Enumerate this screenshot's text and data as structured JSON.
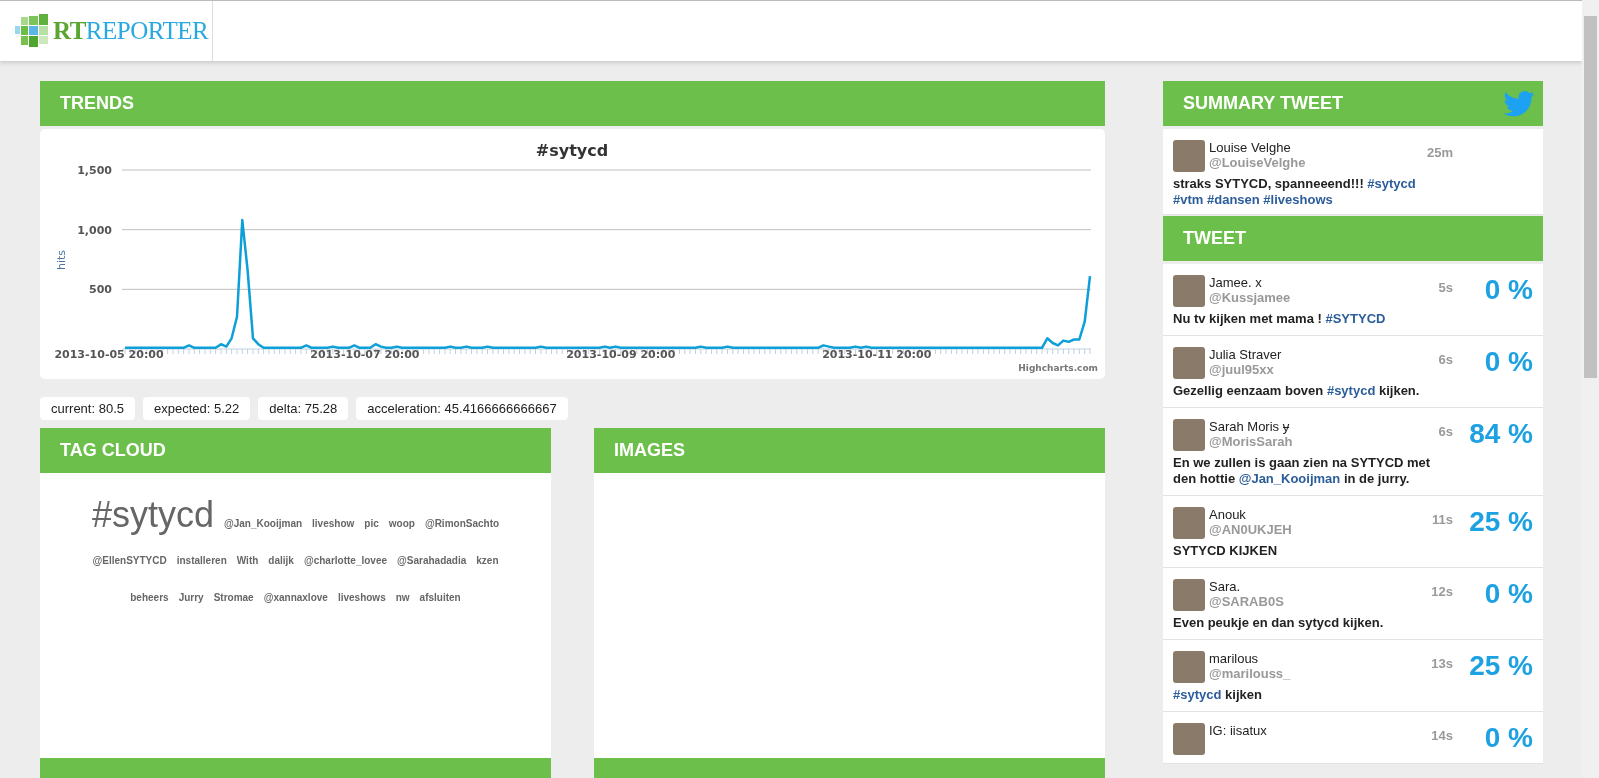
{
  "header": {
    "logo": {
      "prefix": "RT",
      "suffix": "REPORTER"
    }
  },
  "trends": {
    "title": "TRENDS",
    "credit": "Highcharts.com",
    "chart_data": {
      "type": "line",
      "title": "#sytycd",
      "ylabel": "hits",
      "ylim": [
        0,
        1500
      ],
      "yticks": [
        500,
        {
          "value": 1000,
          "label": "1,000"
        },
        {
          "value": 1500,
          "label": "1,500"
        }
      ],
      "categories": [
        "2013-10-05 20:00",
        null,
        null,
        null,
        null,
        null,
        null,
        null,
        null,
        null,
        null,
        null,
        null,
        null,
        null,
        null,
        null,
        null,
        null,
        null,
        null,
        null,
        null,
        null,
        null,
        null,
        null,
        null,
        null,
        null,
        null,
        null,
        null,
        null,
        null,
        null,
        null,
        null,
        null,
        null,
        null,
        null,
        null,
        null,
        null,
        null,
        null,
        null,
        "2013-10-07 20:00",
        null,
        null,
        null,
        null,
        null,
        null,
        null,
        null,
        null,
        null,
        null,
        null,
        null,
        null,
        null,
        null,
        null,
        null,
        null,
        null,
        null,
        null,
        null,
        null,
        null,
        null,
        null,
        null,
        null,
        null,
        null,
        null,
        null,
        null,
        null,
        null,
        null,
        null,
        null,
        null,
        null,
        null,
        null,
        null,
        null,
        null,
        null,
        "2013-10-09 20:00",
        null,
        null,
        null,
        null,
        null,
        null,
        null,
        null,
        null,
        null,
        null,
        null,
        null,
        null,
        null,
        null,
        null,
        null,
        null,
        null,
        null,
        null,
        null,
        null,
        null,
        null,
        null,
        null,
        null,
        null,
        null,
        null,
        null,
        null,
        null,
        null,
        null,
        null,
        null,
        null,
        null,
        null,
        null,
        null,
        null,
        null,
        null,
        "2013-10-11 20:00",
        null,
        null,
        null,
        null,
        null,
        null,
        null,
        null,
        null,
        null,
        null,
        null,
        null,
        null,
        null,
        null,
        null,
        null,
        null,
        null,
        null,
        null,
        null,
        null,
        null,
        null,
        null,
        null,
        null,
        null,
        null,
        null,
        null,
        null,
        null,
        null,
        null,
        null,
        null,
        null
      ],
      "series": [
        {
          "color": "#0d9fd8",
          "values": [
            null,
            null,
            null,
            10,
            10,
            10,
            10,
            10,
            10,
            10,
            10,
            10,
            10,
            10,
            10,
            30,
            10,
            10,
            10,
            10,
            10,
            40,
            20,
            90,
            270,
            1080,
            660,
            90,
            40,
            10,
            10,
            10,
            10,
            10,
            10,
            10,
            10,
            30,
            10,
            10,
            10,
            10,
            20,
            10,
            10,
            10,
            30,
            10,
            10,
            10,
            40,
            20,
            10,
            10,
            20,
            10,
            10,
            10,
            10,
            10,
            10,
            10,
            10,
            10,
            20,
            10,
            10,
            20,
            10,
            10,
            10,
            20,
            10,
            10,
            10,
            10,
            10,
            10,
            10,
            10,
            10,
            20,
            10,
            10,
            10,
            10,
            10,
            10,
            10,
            10,
            10,
            10,
            10,
            20,
            10,
            20,
            10,
            10,
            10,
            10,
            10,
            10,
            10,
            10,
            10,
            10,
            10,
            10,
            10,
            10,
            10,
            20,
            10,
            10,
            10,
            10,
            20,
            10,
            10,
            10,
            10,
            10,
            10,
            10,
            10,
            10,
            10,
            10,
            10,
            10,
            10,
            10,
            10,
            10,
            30,
            20,
            10,
            10,
            10,
            10,
            20,
            10,
            20,
            10,
            10,
            10,
            10,
            10,
            10,
            10,
            10,
            10,
            10,
            10,
            10,
            10,
            10,
            10,
            10,
            10,
            10,
            10,
            10,
            10,
            10,
            10,
            10,
            10,
            10,
            10,
            10,
            10,
            10,
            10,
            10,
            10,
            90,
            50,
            30,
            70,
            60,
            80,
            80,
            230,
            610
          ]
        }
      ]
    }
  },
  "stats": [
    "current: 80.5",
    "expected: 5.22",
    "delta: 75.28",
    "acceleration: 45.4166666666667"
  ],
  "tag_cloud": {
    "title": "TAG CLOUD",
    "tags": [
      {
        "text": "#sytycd",
        "kind": "large"
      },
      {
        "text": "@Jan_Kooijman",
        "kind": "small"
      },
      {
        "text": "liveshow",
        "kind": "small"
      },
      {
        "text": "pic",
        "kind": "small"
      },
      {
        "text": "woop",
        "kind": "small"
      },
      {
        "text": "@RimonSachto",
        "kind": "small"
      },
      {
        "text": "@EllenSYTYCD",
        "kind": "small"
      },
      {
        "text": "installeren",
        "kind": "small"
      },
      {
        "text": "With",
        "kind": "small"
      },
      {
        "text": "dalijk",
        "kind": "small"
      },
      {
        "text": "@charlotte_lovee",
        "kind": "small"
      },
      {
        "text": "@Sarahadadia",
        "kind": "small"
      },
      {
        "text": "kzen",
        "kind": "small"
      },
      {
        "text": "beheers",
        "kind": "small"
      },
      {
        "text": "Jurry",
        "kind": "small"
      },
      {
        "text": "Stromae",
        "kind": "small"
      },
      {
        "text": "@xannaxlove",
        "kind": "small"
      },
      {
        "text": "liveshows",
        "kind": "small"
      },
      {
        "text": "nw",
        "kind": "small"
      },
      {
        "text": "afsluiten",
        "kind": "small"
      }
    ]
  },
  "images": {
    "title": "IMAGES"
  },
  "summary": {
    "title": "SUMMARY TWEET",
    "tweet": {
      "name": "Louise Velghe",
      "handle": "@LouiseVelghe",
      "time": "25m",
      "text": [
        {
          "t": "straks SYTYCD, spanneeend!!!",
          "link": false
        },
        {
          "t": "#sytycd",
          "link": true
        },
        {
          "t": "#vtm",
          "link": true
        },
        {
          "t": "#dansen",
          "link": true
        },
        {
          "t": "#liveshows",
          "link": true
        }
      ]
    }
  },
  "tweets": {
    "title": "TWEET",
    "items": [
      {
        "name": "Jamee. x",
        "handle": "@Kussjamee",
        "time": "5s",
        "percent": "0 %",
        "text": [
          {
            "t": "Nu tv kijken met mama !",
            "link": false
          },
          {
            "t": "#SYTYCD",
            "link": true
          }
        ]
      },
      {
        "name": "Julia Straver",
        "handle": "@juul95xx",
        "time": "6s",
        "percent": "0 %",
        "text": [
          {
            "t": "Gezellig eenzaam boven",
            "link": false
          },
          {
            "t": "#sytycd",
            "link": true
          },
          {
            "t": "kijken.",
            "link": false
          }
        ]
      },
      {
        "name": "Sarah Moris ɏ",
        "handle": "@MorisSarah",
        "time": "6s",
        "percent": "84 %",
        "text": [
          {
            "t": "En we zullen is gaan zien na SYTYCD met den hottie",
            "link": false
          },
          {
            "t": "@Jan_Kooijman",
            "link": true
          },
          {
            "t": "in de jurry.",
            "link": false
          }
        ]
      },
      {
        "name": "Anouk",
        "handle": "@AN0UKJEH",
        "time": "11s",
        "percent": "25 %",
        "text": [
          {
            "t": "SYTYCD KIJKEN",
            "link": false
          }
        ]
      },
      {
        "name": "Sara.",
        "handle": "@SARAB0S",
        "time": "12s",
        "percent": "0 %",
        "text": [
          {
            "t": "Even peukje en dan sytycd kijken.",
            "link": false
          }
        ]
      },
      {
        "name": "marilous",
        "handle": "@marilouss_",
        "time": "13s",
        "percent": "25 %",
        "text": [
          {
            "t": "#sytycd",
            "link": true
          },
          {
            "t": "kijken",
            "link": false
          }
        ]
      },
      {
        "name": "IG: iisatux",
        "time": "14s",
        "percent": "0 %"
      }
    ]
  }
}
